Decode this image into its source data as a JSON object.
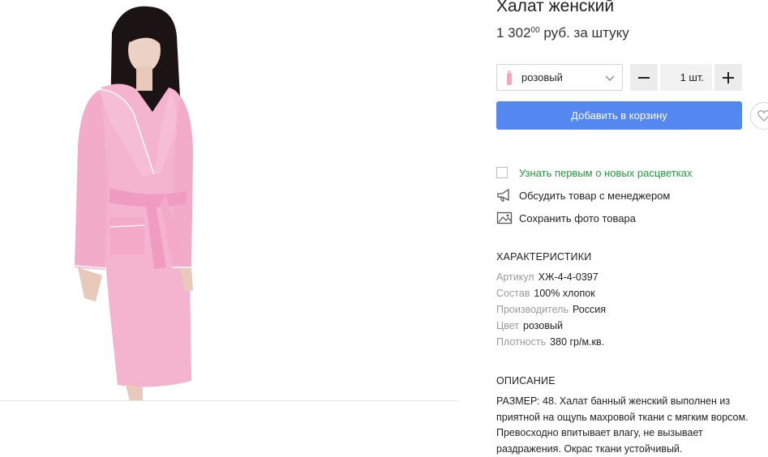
{
  "product": {
    "title": "Халат женский",
    "price_main": "1 302",
    "price_cents": "00",
    "price_unit": "руб. за штуку"
  },
  "color_select": {
    "value": "розовый",
    "swatch_color": "#f4a6c4"
  },
  "quantity": {
    "minus": "−",
    "value": "1 шт.",
    "plus": "+"
  },
  "add_to_cart": "Добавить в корзину",
  "actions": {
    "notify_new_colors": "Узнать первым о новых расцветках",
    "discuss_with_manager": "Обсудить товар с менеджером",
    "save_photo": "Сохранить фото товара"
  },
  "characteristics": {
    "heading": "ХАРАКТЕРИСТИКИ",
    "items": [
      {
        "label": "Артикул",
        "value": "ХЖ-4-4-0397"
      },
      {
        "label": "Состав",
        "value": "100% хлопок"
      },
      {
        "label": "Производитель",
        "value": "Россия"
      },
      {
        "label": "Цвет",
        "value": "розовый"
      },
      {
        "label": "Плотность",
        "value": "380 гр/м.кв."
      }
    ]
  },
  "description": {
    "heading": "ОПИСАНИЕ",
    "text": "РАЗМЕР: 48. Халат банный женский выполнен из приятной на ощупь махровой ткани с мягким ворсом. Превосходно впитывает влагу, не вызывает раздражения. Окрас ткани устойчивый."
  },
  "colors": {
    "accent": "#5587f0",
    "link_green": "#1f9b3a",
    "robe_pink": "#f4b3cf"
  }
}
